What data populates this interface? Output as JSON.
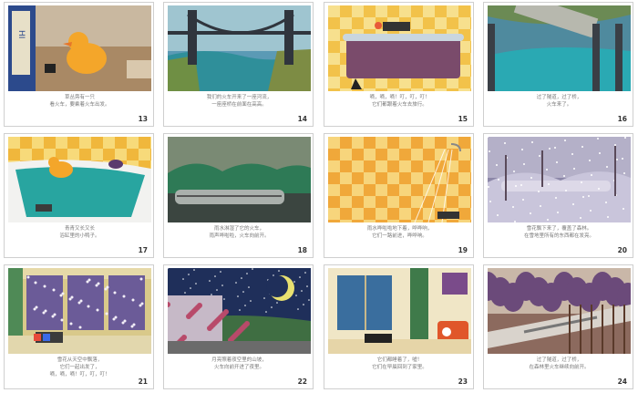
{
  "pages": [
    {
      "number": "13",
      "caption": [
        "草丛旁有一只",
        "看火车，要乘着火车出发。"
      ]
    },
    {
      "number": "14",
      "caption": [
        "我们的火车开来了一座河流，",
        "一座座桥在前面在高高。"
      ]
    },
    {
      "number": "15",
      "caption": [
        "嘀，嘀，嘀！叮，叮，叮！",
        "它们都跟着火车去旅行。"
      ]
    },
    {
      "number": "16",
      "caption": [
        "过了隧道，过了桥，",
        "火车来了。"
      ]
    },
    {
      "number": "17",
      "caption": [
        "青青又长又长",
        "浴缸里的小鸭子。"
      ]
    },
    {
      "number": "18",
      "caption": [
        "雨水淋湿了它的火车，",
        "雨声哗啦啦，火车向前开。"
      ]
    },
    {
      "number": "19",
      "caption": [
        "雨水哗啦啦地下着，哗哗响，",
        "它们一路前进，哗哗响。"
      ]
    },
    {
      "number": "20",
      "caption": [
        "雪花飘下来了，覆盖了森林。",
        "在雪地里所有的东西都在发亮。"
      ]
    },
    {
      "number": "21",
      "caption": [
        "雪花从天空中飘落，",
        "它们一起出发了，",
        "嘀，嘀，嘀！叮，叮，叮！"
      ]
    },
    {
      "number": "22",
      "caption": [
        "月亮照着夜空里的山坡，",
        "火车向前开进了夜里。"
      ]
    },
    {
      "number": "23",
      "caption": [
        "它们都睡着了，嘘！",
        "它们在早晨回到了家里。"
      ]
    },
    {
      "number": "24",
      "caption": [
        "过了隧道，过了桥，",
        "在森林里火车继续向前开。"
      ]
    }
  ],
  "illustrations": [
    "rubber-duck-toy-train",
    "bridge-over-river",
    "bathtub-checkered-wall",
    "train-crossing-bridge",
    "bathtub-with-duck",
    "train-in-rain",
    "shower-checkered-wall",
    "train-in-snow",
    "window-with-snow",
    "moonlit-flowers-train",
    "window-radio-toy-train",
    "train-in-forest"
  ]
}
